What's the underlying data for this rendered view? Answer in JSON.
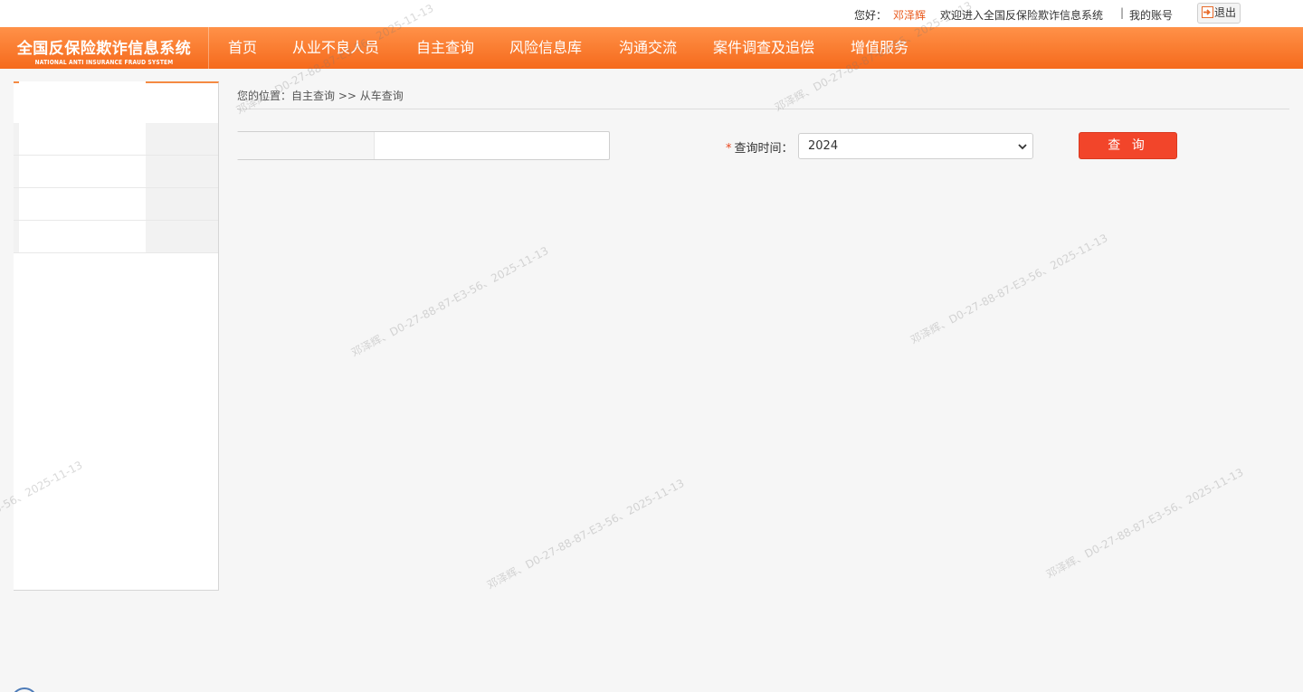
{
  "topbar": {
    "greeting": "您好：",
    "username": "邓泽辉",
    "welcome": "欢迎进入全国反保险欺诈信息系统",
    "separator": "|",
    "my_account": "我的账号",
    "logout": "退出"
  },
  "brand": {
    "name_cn": "全国反保险欺诈信息系统",
    "name_en": "NATIONAL ANTI INSURANCE FRAUD SYSTEM"
  },
  "nav": {
    "items": [
      "首页",
      "从业不良人员",
      "自主查询",
      "风险信息库",
      "沟通交流",
      "案件调查及追偿",
      "增值服务"
    ]
  },
  "breadcrumb": "您的位置：自主查询 >> 从车查询",
  "form": {
    "input_value": "",
    "required_mark": "*",
    "time_label": "查询时间：",
    "year_selected": "2024",
    "query_button": "查 询"
  },
  "watermark": "邓泽辉、D0-27-88-87-E3-56、2025-11-13"
}
